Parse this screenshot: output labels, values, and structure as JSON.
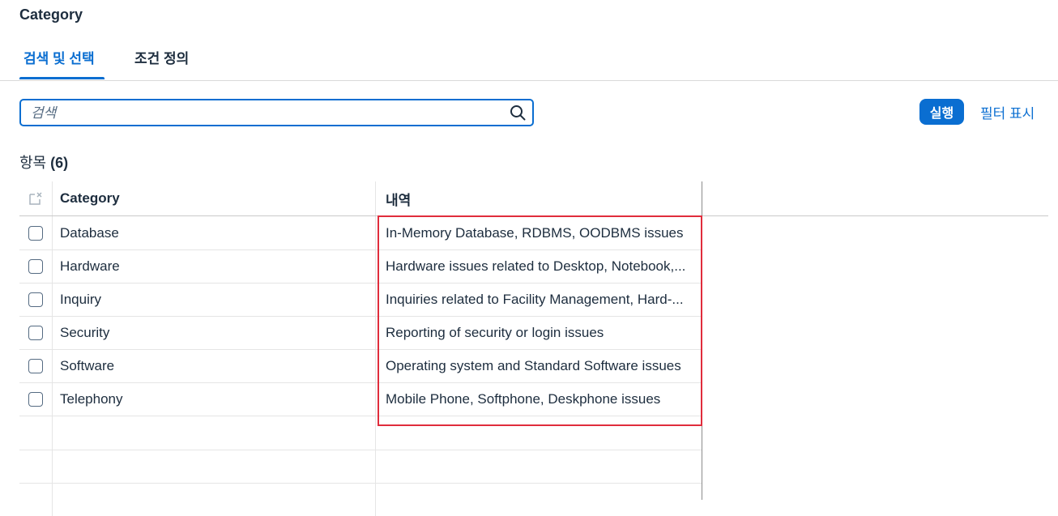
{
  "header": {
    "title": "Category"
  },
  "tabs": [
    {
      "label": "검색 및 선택",
      "active": true
    },
    {
      "label": "조건 정의",
      "active": false
    }
  ],
  "search": {
    "placeholder": "검색",
    "value": ""
  },
  "toolbar": {
    "go_label": "실행",
    "filter_label": "필터 표시"
  },
  "items": {
    "label": "항목",
    "count": "(6)"
  },
  "table": {
    "columns": [
      "Category",
      "내역"
    ],
    "rows": [
      {
        "category": "Database",
        "description": "In-Memory Database, RDBMS, OODBMS issues"
      },
      {
        "category": "Hardware",
        "description": "Hardware issues related to Desktop, Notebook,..."
      },
      {
        "category": "Inquiry",
        "description": "Inquiries related to Facility Management, Hard-..."
      },
      {
        "category": "Security",
        "description": "Reporting of security or login issues"
      },
      {
        "category": "Software",
        "description": "Operating system and Standard Software issues"
      },
      {
        "category": "Telephony",
        "description": "Mobile Phone, Softphone, Deskphone issues"
      }
    ]
  },
  "colors": {
    "accent": "#0a6ed1",
    "highlight": "#e02d3c",
    "text": "#1d2d3e"
  },
  "icons": {
    "search": "search-icon",
    "select_all": "clear-selection-icon"
  }
}
